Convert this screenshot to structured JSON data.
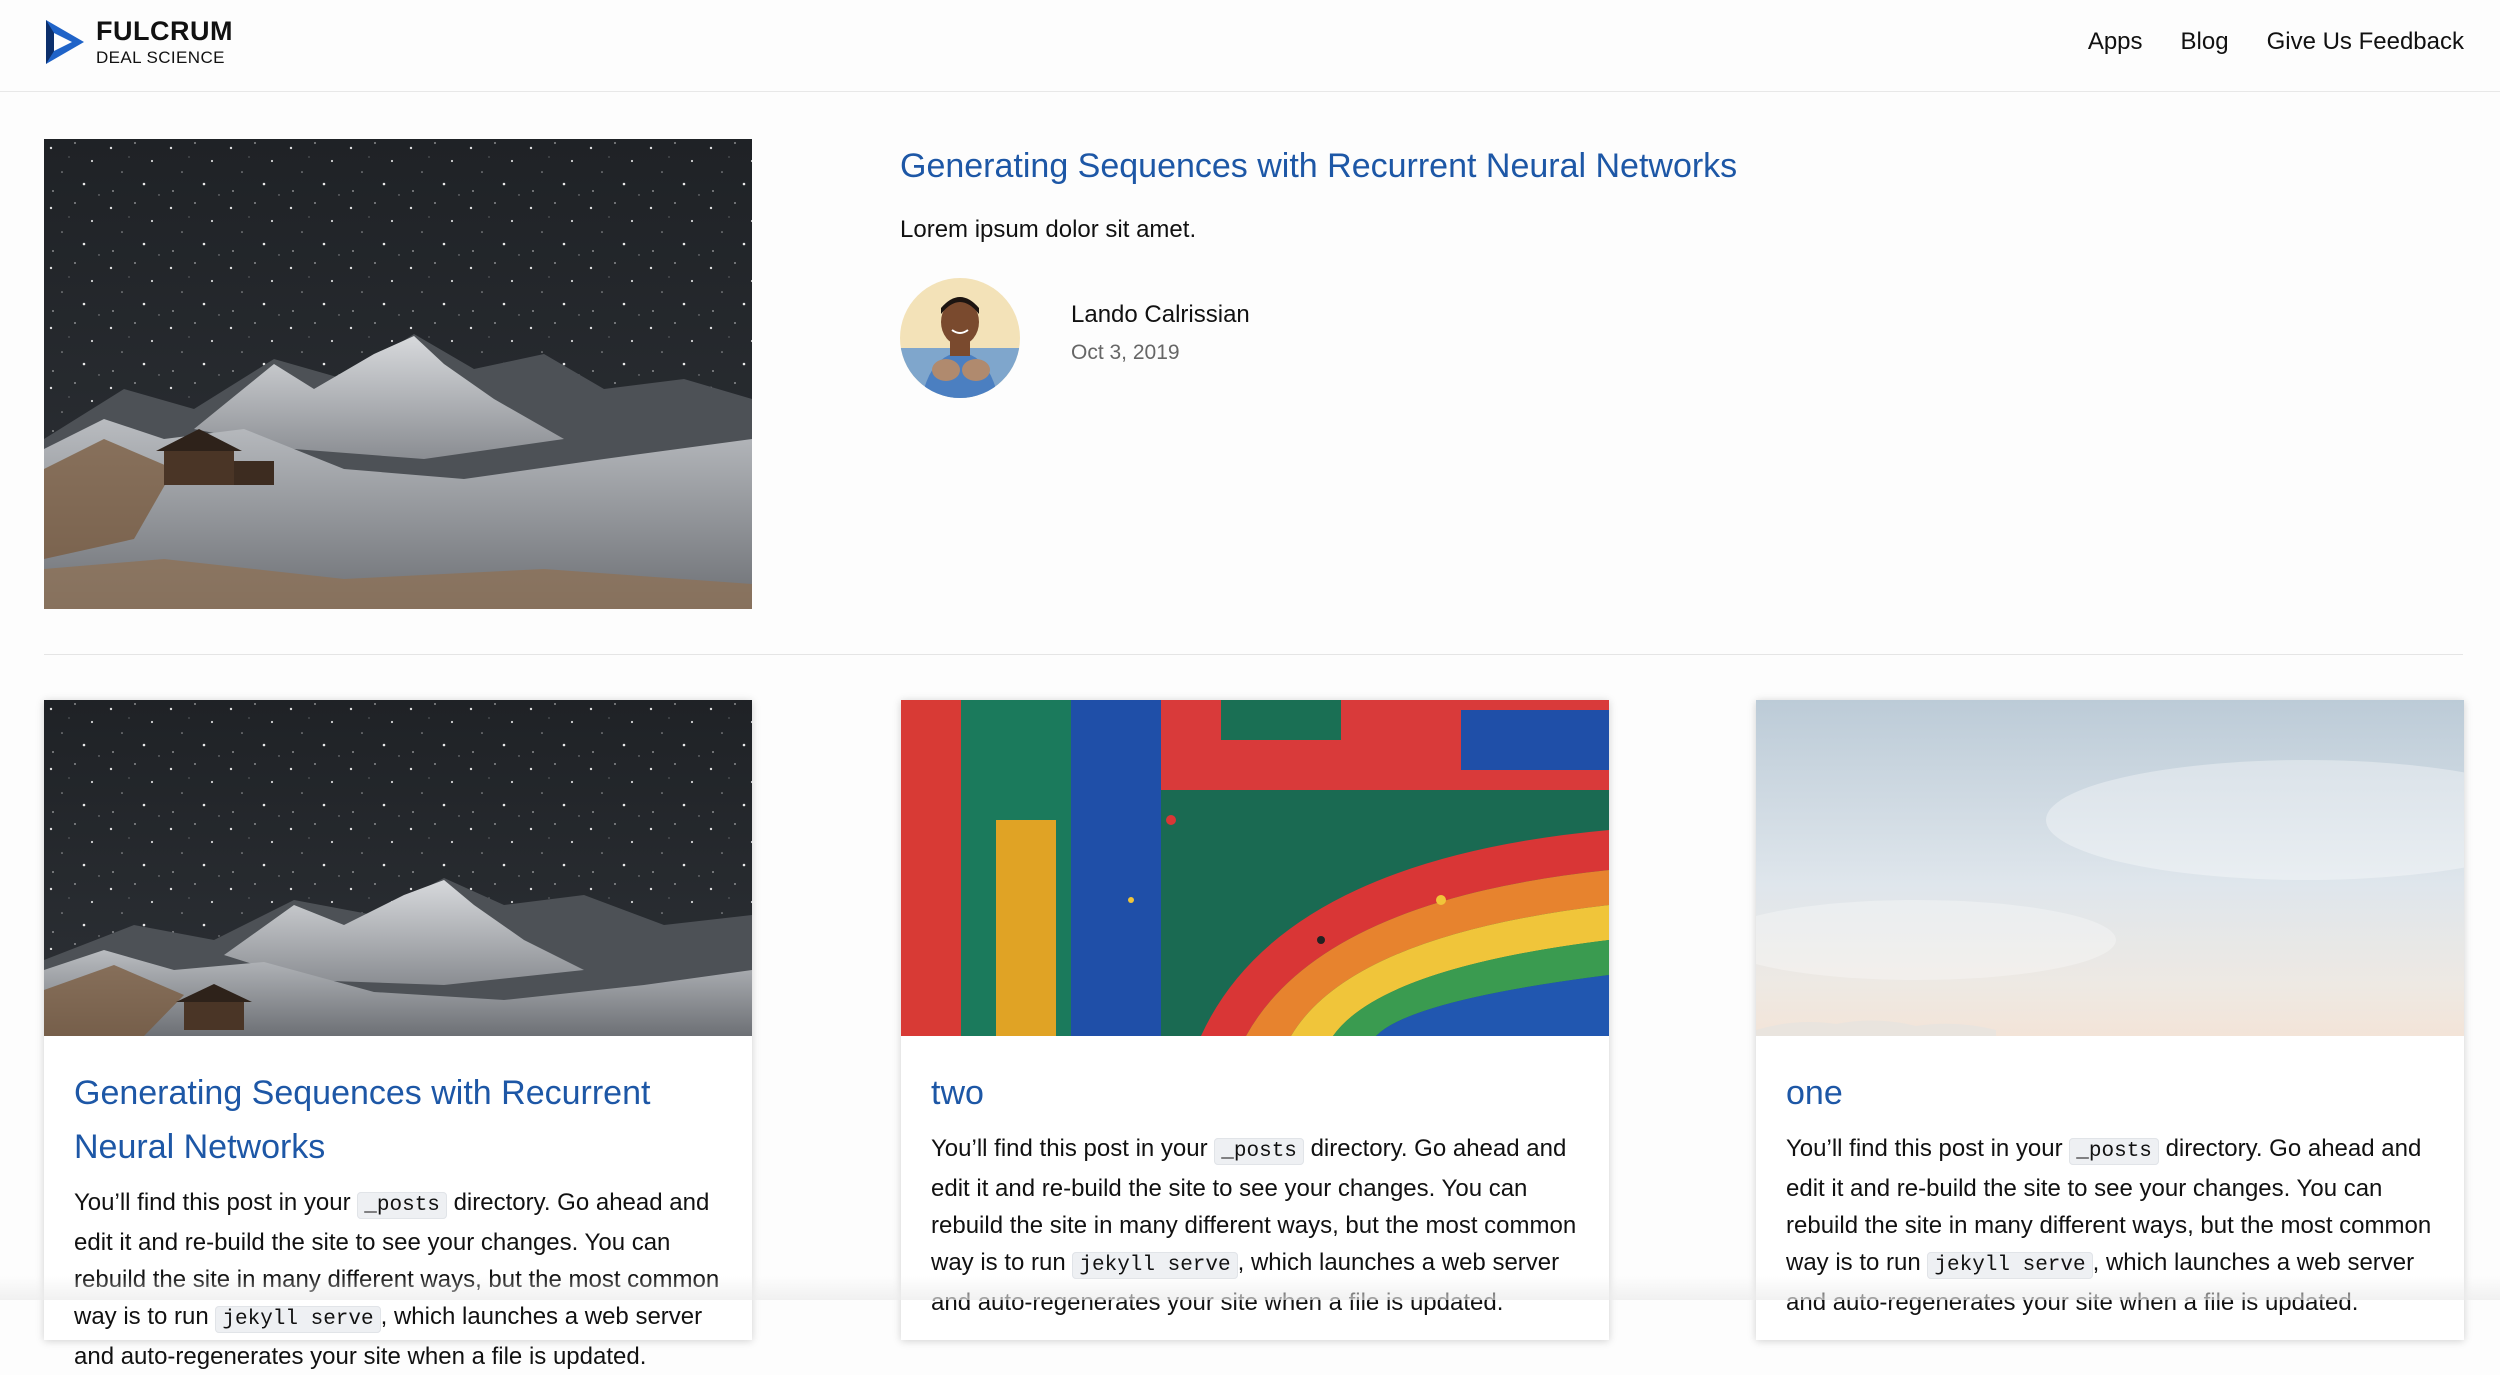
{
  "brand": {
    "name": "FULCRUM",
    "subtitle": "DEAL SCIENCE",
    "logo_icon": "play-triangle-icon",
    "colors": {
      "logo_blue": "#1f63c8",
      "logo_dark": "#0c2f6b"
    }
  },
  "nav": {
    "apps": "Apps",
    "blog": "Blog",
    "feedback": "Give Us Feedback"
  },
  "featured": {
    "title": "Generating Sequences with Recurrent Neural Networks",
    "excerpt": "Lorem ipsum dolor sit amet.",
    "author": "Lando Calrissian",
    "date": "Oct 3, 2019",
    "image": "night-mountain-landscape"
  },
  "cards": [
    {
      "title": "Generating Sequences with Recurrent Neural Networks",
      "image": "night-mountain-landscape",
      "excerpt_pre": "You’ll find this post in your ",
      "code1": "_posts",
      "excerpt_mid": " directory. Go ahead and edit it and re-build the site to see your changes. You can rebuild the site in many different ways, but the most common way is to run ",
      "code2": "jekyll serve",
      "excerpt_post": ", which launches a web server and auto-regenerates your site when a file is updated."
    },
    {
      "title": "two",
      "image": "rainbow-paint",
      "excerpt_pre": "You’ll find this post in your ",
      "code1": "_posts",
      "excerpt_mid": " directory. Go ahead and edit it and re-build the site to see your changes. You can rebuild the site in many different ways, but the most common way is to run ",
      "code2": "jekyll serve",
      "excerpt_post": ", which launches a web server and auto-regenerates your site when a file is updated."
    },
    {
      "title": "one",
      "image": "pale-sky",
      "excerpt_pre": "You’ll find this post in your ",
      "code1": "_posts",
      "excerpt_mid": " directory. Go ahead and edit it and re-build the site to see your changes. You can rebuild the site in many different ways, but the most common way is to run ",
      "code2": "jekyll serve",
      "excerpt_post": ", which launches a web server and auto-regenerates your site when a file is updated."
    }
  ],
  "colors": {
    "link": "#1d57a6",
    "divider": "#e5e5e5",
    "code_bg": "#eef0f3"
  }
}
